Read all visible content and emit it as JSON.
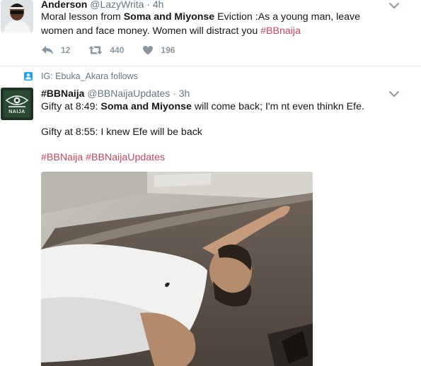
{
  "tweet1": {
    "name": "Anderson",
    "handle": "@LazyWrita",
    "separator": "·",
    "time": "4h",
    "text_before": "Moral lesson from ",
    "text_bold": "Soma and Miyonse",
    "text_after": " Eviction :As a young man, leave women and face money. Women will distract you ",
    "hashtag": "#BBnaija",
    "replies": "12",
    "retweets": "440",
    "likes": "196"
  },
  "context": {
    "text": "IG: Ebuka_Akara follows"
  },
  "tweet2": {
    "name": "#BBNaija",
    "handle": "@BBNaijaUpdates",
    "separator": "·",
    "time": "3h",
    "line1_before": "Gifty at 8:49: ",
    "line1_bold": "Soma and Miyonse",
    "line1_after": " will come back; I'm nt even thinkn Efe.",
    "line2": "Gifty at 8:55: I knew Efe will be back",
    "hashtag1": "#BBNaija",
    "hashtag2": "#BBNaijaUpdates",
    "avatar_badge": "NAIJA"
  },
  "icons": [
    "reply-icon",
    "retweet-icon",
    "heart-icon",
    "chevron-down-icon",
    "follow-context-icon"
  ],
  "colors": {
    "hashtag": "#c8475a",
    "muted": "#657786",
    "action": "#8a97a3",
    "context_icon": "#1da1f2"
  }
}
